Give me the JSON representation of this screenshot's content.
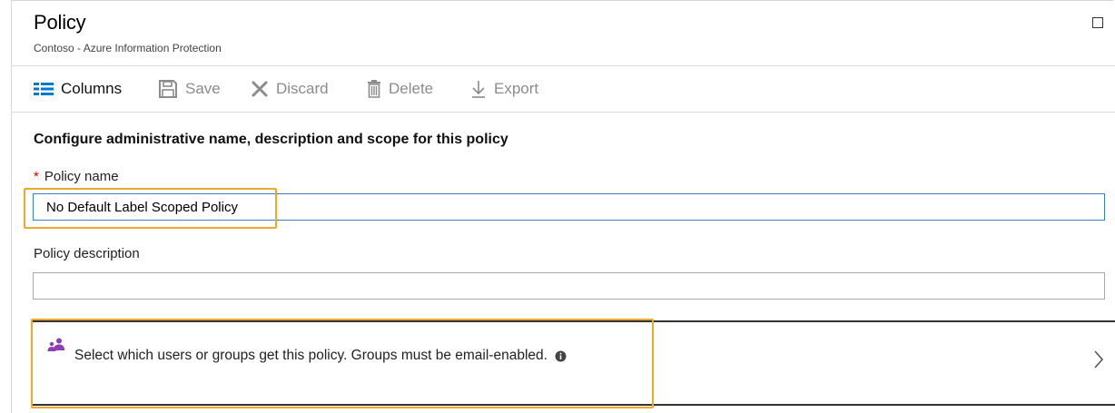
{
  "header": {
    "title": "Policy",
    "subtitle": "Contoso - Azure Information Protection"
  },
  "toolbar": {
    "columns_label": "Columns",
    "save_label": "Save",
    "discard_label": "Discard",
    "delete_label": "Delete",
    "export_label": "Export"
  },
  "form": {
    "heading": "Configure administrative name, description and scope for this policy",
    "required_marker": "*",
    "policy_name_label": "Policy name",
    "policy_name_value": "No Default Label Scoped Policy",
    "policy_description_label": "Policy description",
    "policy_description_value": ""
  },
  "scope": {
    "text": "Select which users or groups get this policy. Groups must be email-enabled."
  },
  "colors": {
    "accent": "#0078d4",
    "highlight": "#f0a82a",
    "icon_purple": "#8a3fb5",
    "focus_border": "#3c7ec7"
  },
  "icons": {
    "columns": "columns-icon",
    "save": "save-icon",
    "discard": "discard-icon",
    "delete": "delete-icon",
    "export": "export-icon",
    "users": "users-group-icon",
    "info": "info-icon",
    "chevron": "chevron-right-icon",
    "maximize": "maximize-icon"
  }
}
